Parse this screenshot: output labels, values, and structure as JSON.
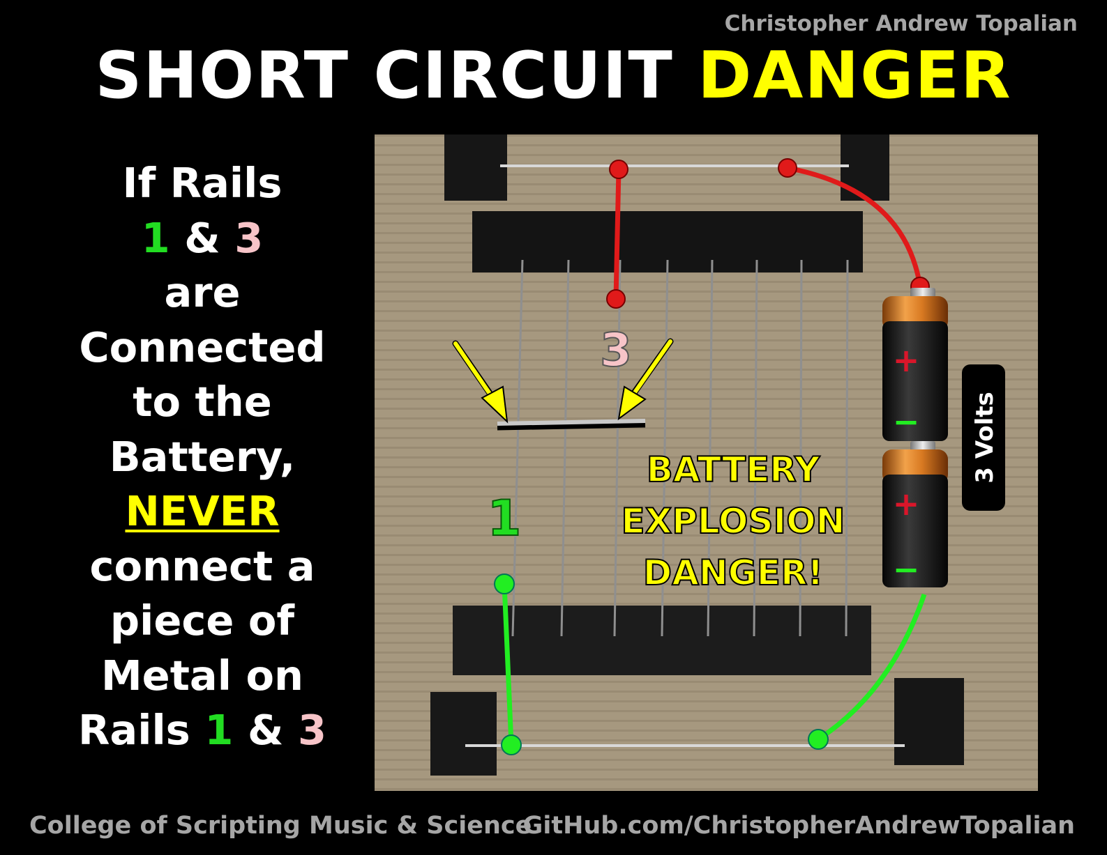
{
  "author": "Christopher Andrew Topalian",
  "title": {
    "part1": "SHORT CIRCUIT ",
    "part2": "DANGER"
  },
  "side": {
    "l1": "If Rails",
    "l2a": "1",
    "l2b": " & ",
    "l2c": "3",
    "l3": "are",
    "l4": "Connected",
    "l5": "to the",
    "l6": "Battery,",
    "l7": "NEVER",
    "l8": "connect a",
    "l9": "piece of",
    "l10": "Metal on",
    "l11a": "Rails ",
    "l11b": "1",
    "l11c": " & ",
    "l11d": "3"
  },
  "diagram": {
    "rail1_label": "1",
    "rail3_label": "3",
    "battery_plus": "+",
    "battery_minus": "−",
    "volts_label": "3 Volts",
    "warning": [
      "BATTERY",
      "EXPLOSION",
      "DANGER!"
    ]
  },
  "footer": {
    "left": "College of Scripting Music & Science",
    "right": "GitHub.com/ChristopherAndrewTopalian"
  },
  "colors": {
    "accent": "#ffff00",
    "rail1": "#22dd22",
    "rail3": "#f7c4c8",
    "wire_red": "#e01a1a",
    "wire_green": "#22ee22"
  }
}
